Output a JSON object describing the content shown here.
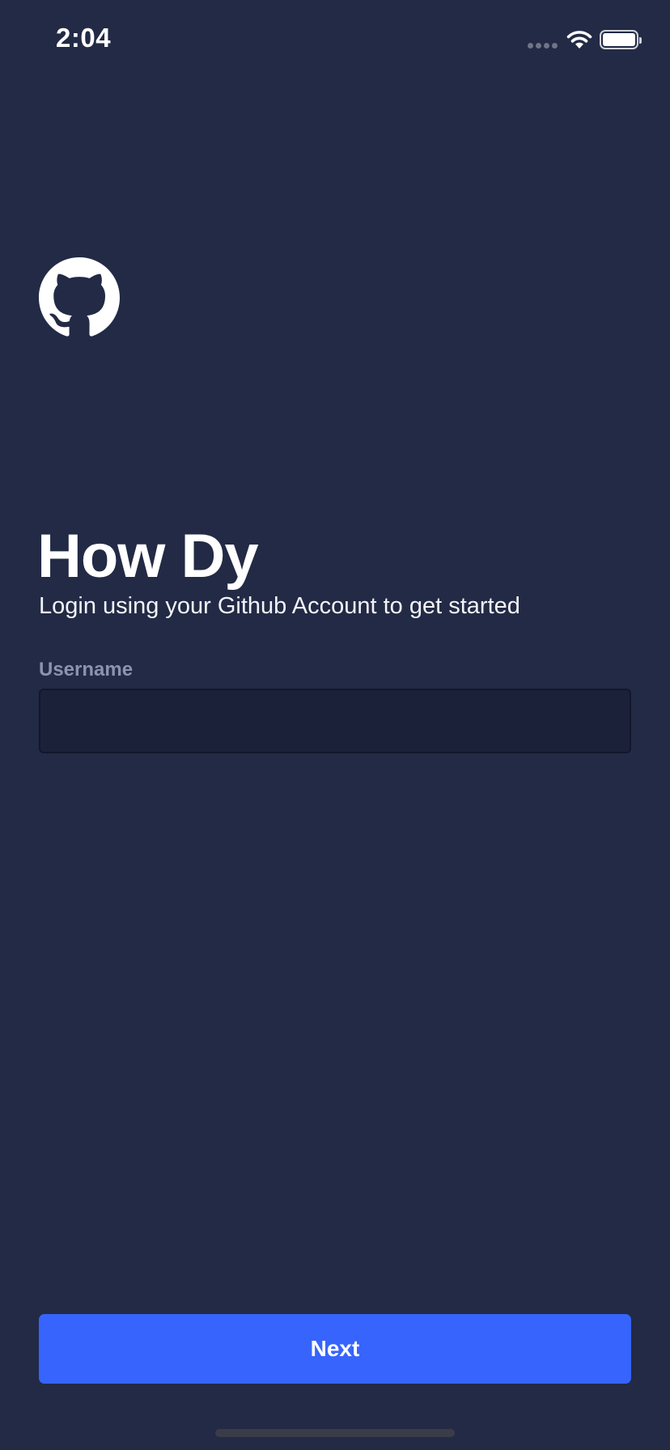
{
  "status_bar": {
    "time": "2:04",
    "signal_icon": "signal-dots-icon",
    "wifi_icon": "wifi-icon",
    "battery_icon": "battery-icon",
    "battery_level": 1.0
  },
  "logo": {
    "icon": "github-octocat-icon"
  },
  "header": {
    "title": "How Dy",
    "subtitle": "Login using your Github Account to get started"
  },
  "form": {
    "username_label": "Username",
    "username_value": "",
    "username_placeholder": ""
  },
  "actions": {
    "next_label": "Next"
  },
  "colors": {
    "background": "#222a45",
    "input_background": "#1c213a",
    "label": "#8c93ad",
    "accent": "#3664fd",
    "text": "#ffffff"
  }
}
